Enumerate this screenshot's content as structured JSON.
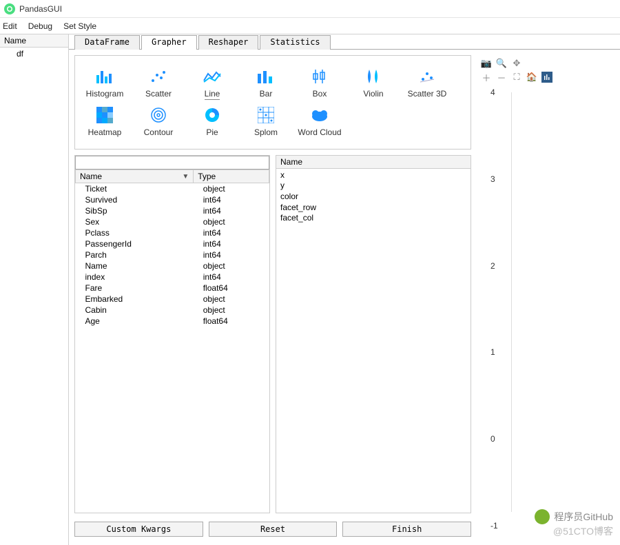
{
  "window": {
    "title": "PandasGUI"
  },
  "menubar": [
    "Edit",
    "Debug",
    "Set Style"
  ],
  "sidebar": {
    "header": "Name",
    "items": [
      "df"
    ]
  },
  "tabs": {
    "items": [
      "DataFrame",
      "Grapher",
      "Reshaper",
      "Statistics"
    ],
    "active": 1
  },
  "chart_types": [
    {
      "label": "Histogram",
      "icon": "histogram-icon"
    },
    {
      "label": "Scatter",
      "icon": "scatter-icon"
    },
    {
      "label": "Line",
      "icon": "line-icon",
      "selected": true
    },
    {
      "label": "Bar",
      "icon": "bar-icon"
    },
    {
      "label": "Box",
      "icon": "box-icon"
    },
    {
      "label": "Violin",
      "icon": "violin-icon"
    },
    {
      "label": "Scatter 3D",
      "icon": "scatter3d-icon"
    },
    {
      "label": "Heatmap",
      "icon": "heatmap-icon"
    },
    {
      "label": "Contour",
      "icon": "contour-icon"
    },
    {
      "label": "Pie",
      "icon": "pie-icon"
    },
    {
      "label": "Splom",
      "icon": "splom-icon"
    },
    {
      "label": "Word Cloud",
      "icon": "wordcloud-icon"
    }
  ],
  "columns_table": {
    "headers": [
      "Name",
      "Type"
    ],
    "rows": [
      {
        "name": "Ticket",
        "type": "object"
      },
      {
        "name": "Survived",
        "type": "int64"
      },
      {
        "name": "SibSp",
        "type": "int64"
      },
      {
        "name": "Sex",
        "type": "object"
      },
      {
        "name": "Pclass",
        "type": "int64"
      },
      {
        "name": "PassengerId",
        "type": "int64"
      },
      {
        "name": "Parch",
        "type": "int64"
      },
      {
        "name": "Name",
        "type": "object"
      },
      {
        "name": "index",
        "type": "int64"
      },
      {
        "name": "Fare",
        "type": "float64"
      },
      {
        "name": "Embarked",
        "type": "object"
      },
      {
        "name": "Cabin",
        "type": "object"
      },
      {
        "name": "Age",
        "type": "float64"
      }
    ]
  },
  "aesthetics": {
    "header": "Name",
    "items": [
      "x",
      "y",
      "color",
      "facet_row",
      "facet_col"
    ]
  },
  "buttons": {
    "custom": "Custom Kwargs",
    "reset": "Reset",
    "finish": "Finish"
  },
  "y_ticks": [
    "4",
    "3",
    "2",
    "1",
    "0",
    "-1"
  ],
  "watermark": {
    "line1": "程序员GitHub",
    "line2": "@51CTO博客"
  }
}
